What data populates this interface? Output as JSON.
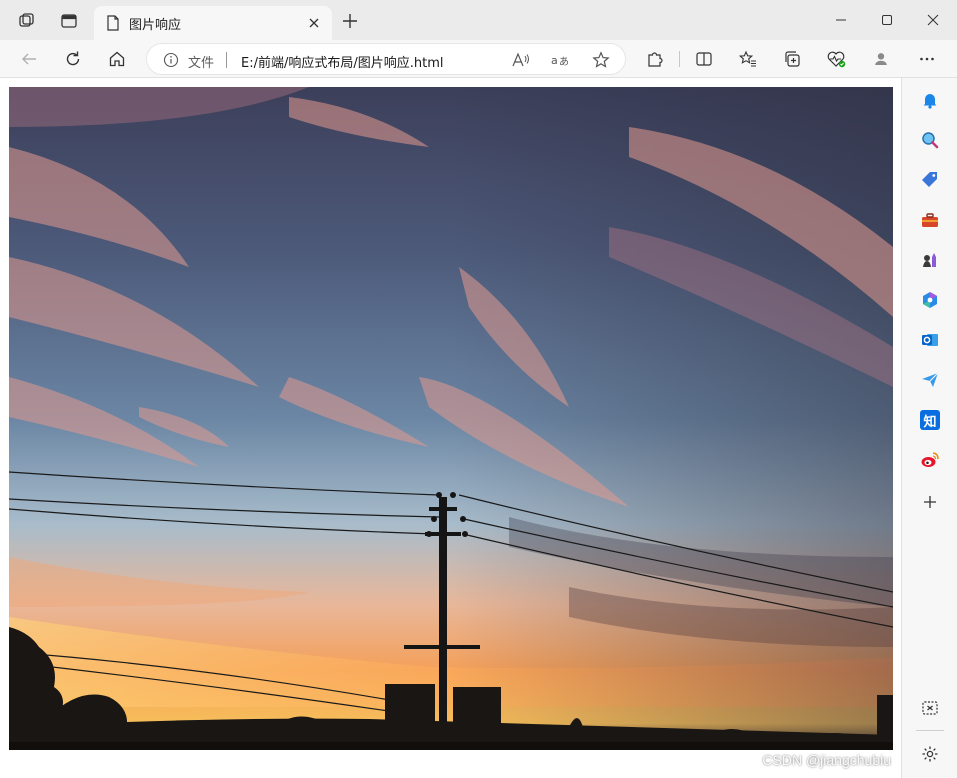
{
  "tab": {
    "title": "图片响应"
  },
  "omnibox": {
    "site_label": "文件",
    "url": "E:/前端/响应式布局/图片响应.html"
  },
  "icons": {
    "workspaces": "workspaces-icon",
    "tab_actions": "vertical-tabs-icon",
    "new_tab": "plus-icon",
    "back": "back-arrow-icon",
    "refresh": "refresh-icon",
    "home": "home-icon",
    "read_aloud": "read-aloud-icon",
    "translate": "translate-icon",
    "favorite": "star-icon",
    "extensions": "puzzle-icon",
    "split_screen": "split-screen-icon",
    "favorites": "favorites-icon",
    "collections": "collections-icon",
    "browser_essentials": "heart-pulse-icon",
    "profile": "profile-icon",
    "more": "ellipsis-icon"
  },
  "sidebar": {
    "items": [
      "bell-icon",
      "search-icon",
      "tag-icon",
      "toolbox-icon",
      "chess-icon",
      "copilot-icon",
      "outlook-icon",
      "send-icon",
      "zhihu-icon",
      "weibo-icon",
      "add-icon"
    ],
    "zhihu_label": "知",
    "bottom": [
      "screenshot-icon",
      "settings-icon"
    ]
  },
  "watermark": "CSDN @jiangchubiu"
}
